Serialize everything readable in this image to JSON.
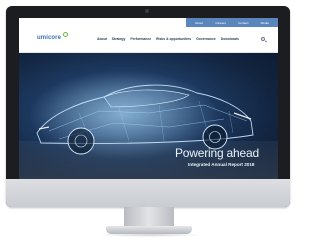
{
  "utility_bar": {
    "items": [
      "About",
      "Careers",
      "Contact",
      "Media"
    ]
  },
  "header": {
    "logo_text": "umicore",
    "nav": [
      "About",
      "Strategy",
      "Performance",
      "Risks & opportunities",
      "Governance",
      "Downloads"
    ],
    "search_icon": "search-icon"
  },
  "hero": {
    "title": "Powering ahead",
    "subtitle": "Integrated Annual Report 2018"
  },
  "colors": {
    "brand_blue": "#3a6fb2",
    "utility_bar": "#5b86bd",
    "logo_accent": "#71b843"
  }
}
